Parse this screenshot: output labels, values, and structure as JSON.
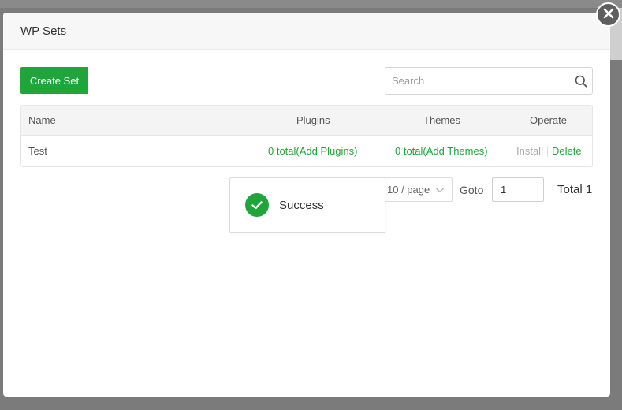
{
  "dialog": {
    "title": "WP Sets",
    "create_label": "Create Set",
    "search_placeholder": "Search"
  },
  "table": {
    "headers": {
      "name": "Name",
      "plugins": "Plugins",
      "themes": "Themes",
      "operate": "Operate"
    },
    "rows": [
      {
        "name": "Test",
        "plugins": "0 total(Add Plugins)",
        "themes": "0 total(Add Themes)",
        "install": "Install",
        "delete": "Delete"
      }
    ]
  },
  "pagination": {
    "page_size": "10 / page",
    "goto_label": "Goto",
    "goto_value": "1",
    "total": "Total 1"
  },
  "toast": {
    "message": "Success"
  },
  "colors": {
    "accent": "#20a53a",
    "header_bg": "#f7f7f7",
    "overlay": "#7b7b7b"
  }
}
